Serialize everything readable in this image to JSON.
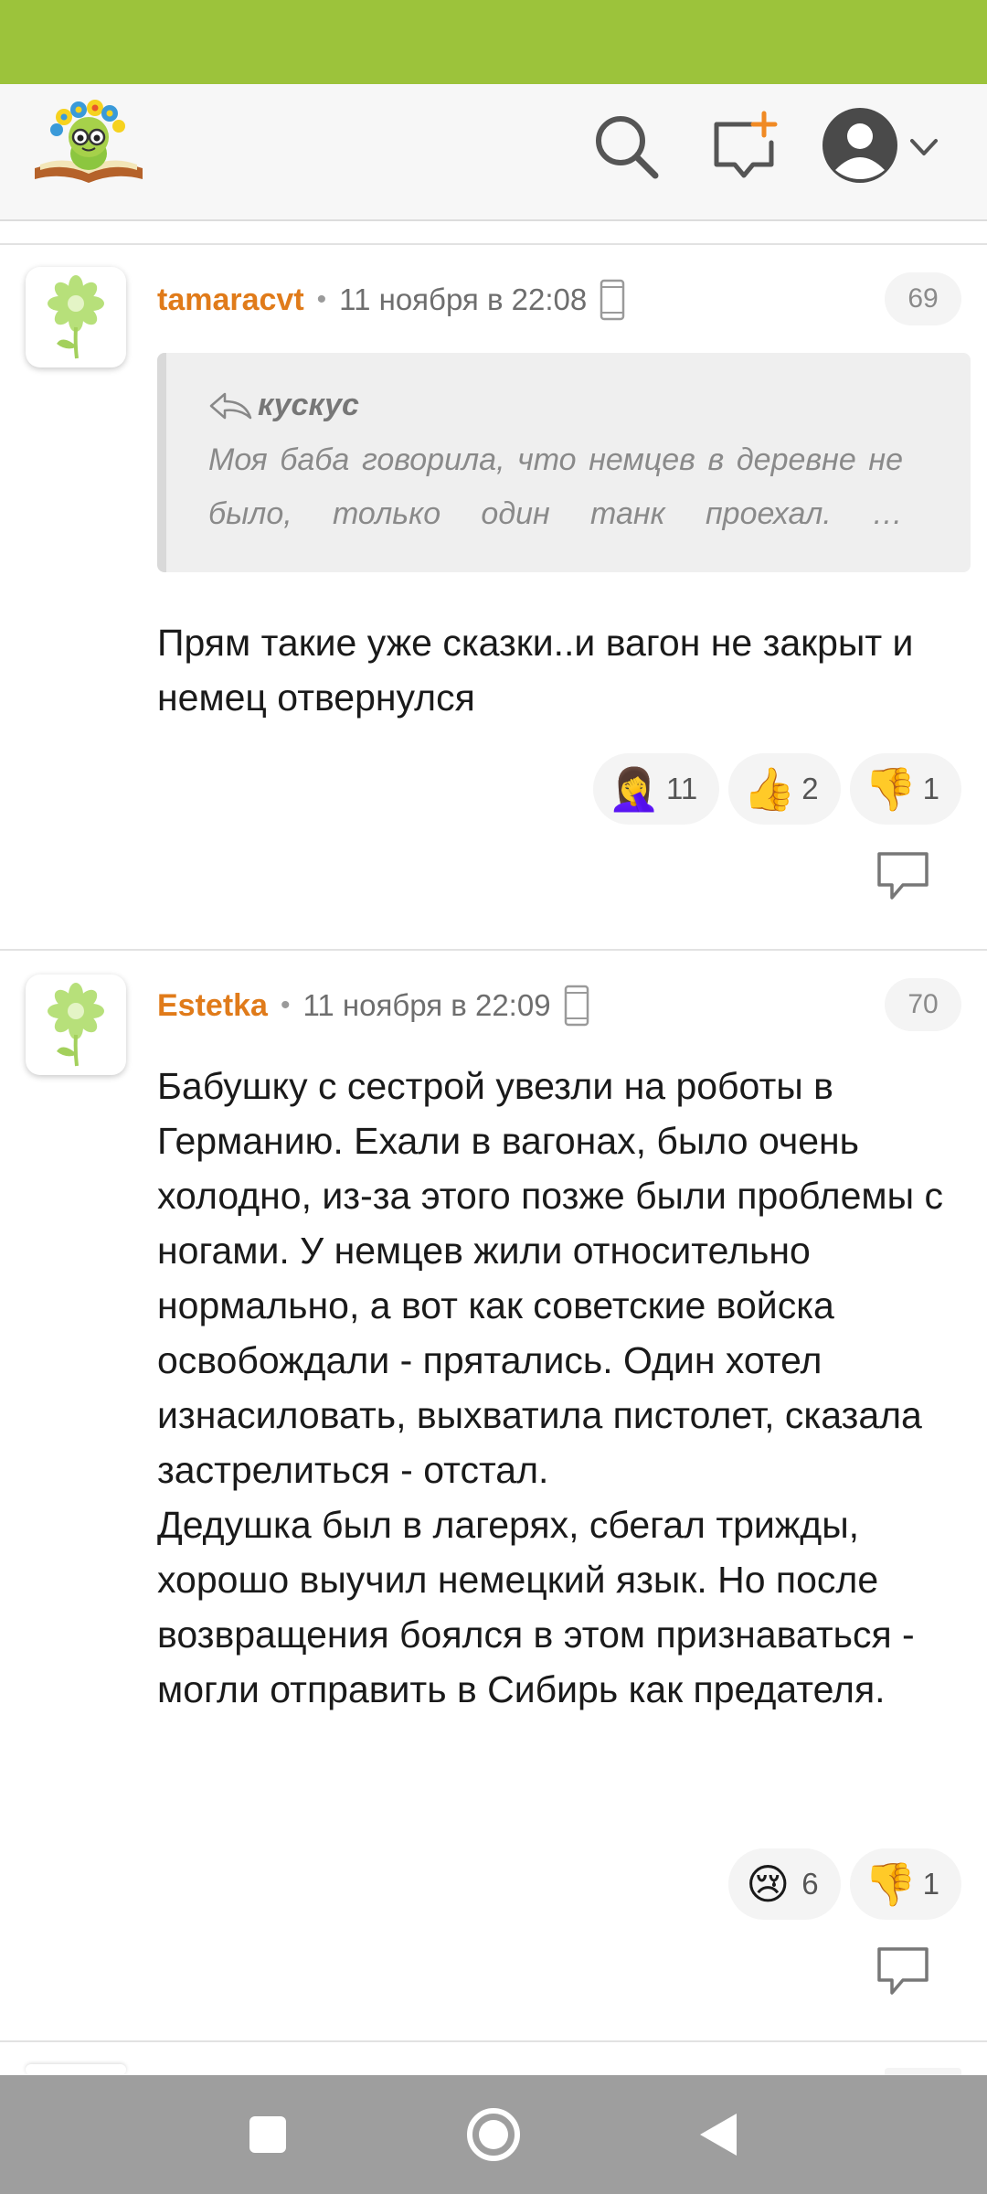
{
  "header": {
    "logo_icon": "bookworm-logo-icon",
    "icons": [
      "search-icon",
      "add-post-icon",
      "avatar-icon",
      "chevron-down-icon"
    ]
  },
  "comments": [
    {
      "author": "tamaracvt",
      "date": "11 ноября в 22:08",
      "number": "69",
      "quote": {
        "author": "кускус",
        "text": "Моя баба говорила, что немцев в деревне не было, только один танк проехал. …"
      },
      "text": "Прям такие уже сказки..и вагон не закрыт и немец отвернулся",
      "reactions": [
        {
          "emoji": "🤦‍♀️",
          "icon": "facepalm-icon",
          "count": "11"
        },
        {
          "emoji": "👍",
          "icon": "thumbs-up-icon",
          "count": "2"
        },
        {
          "emoji": "👎",
          "icon": "thumbs-down-icon",
          "count": "1"
        }
      ]
    },
    {
      "author": "Estetka",
      "date": "11 ноября в 22:09",
      "number": "70",
      "text": "Бабушку с сестрой увезли на роботы в Германию. Ехали в вагонах, было очень холодно, из-за этого позже были проблемы с ногами. У немцев жили относительно нормально, а вот как советские войска освобождали - прятались. Один хотел изнасиловать, выхватила пистолет, сказала застрелиться - отстал.\nДедушка был в лагерях, сбегал трижды, хорошо выучил немецкий язык. Но после возвращения боялся в этом признаваться - могли отправить в Сибирь как предателя.",
      "reactions": [
        {
          "emoji": "😢",
          "icon": "crying-face-icon",
          "count": "6"
        },
        {
          "emoji": "👎",
          "icon": "thumbs-down-icon",
          "count": "1"
        }
      ]
    }
  ],
  "colors": {
    "status_bar": "#9cc33b",
    "author": "#e07b1a",
    "nav_bar": "#9e9e9e"
  }
}
